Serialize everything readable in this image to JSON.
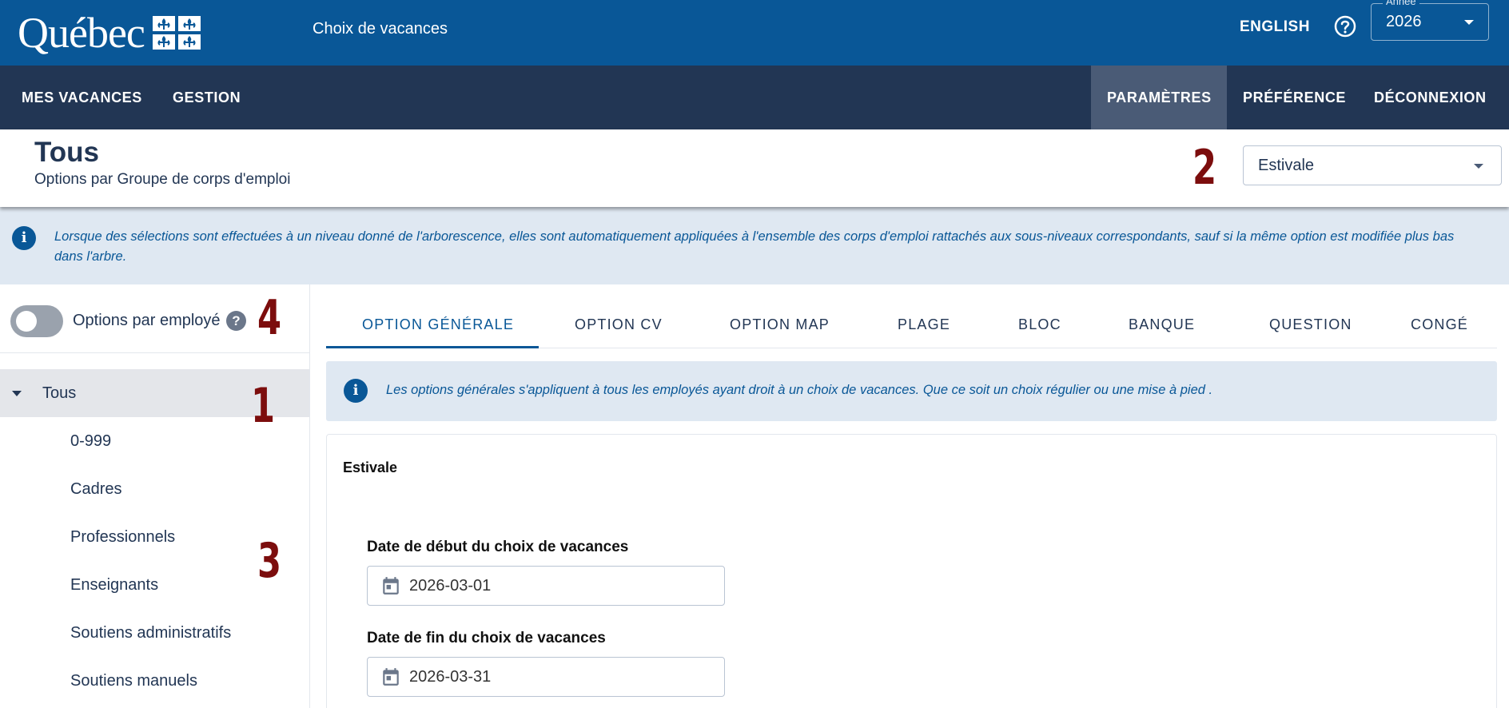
{
  "header": {
    "logo_text": "Québec",
    "app_title": "Choix de vacances",
    "language_link": "ENGLISH",
    "help_icon": "help-circle-icon",
    "year": {
      "legend": "Année",
      "value": "2026"
    }
  },
  "nav": {
    "left": [
      "MES VACANCES",
      "GESTION"
    ],
    "right": [
      "PARAMÈTRES",
      "PRÉFÉRENCE",
      "DÉCONNEXION"
    ],
    "active": "PARAMÈTRES"
  },
  "page": {
    "title": "Tous",
    "subtitle": "Options par Groupe de corps d'emploi",
    "season_select": "Estivale"
  },
  "annotations": [
    "1",
    "2",
    "3",
    "4"
  ],
  "info_banner": "Lorsque des sélections sont effectuées à un niveau donné de l'arborescence, elles sont automatiquement appliquées à l'ensemble des corps d'emploi rattachés aux sous-niveaux correspondants, sauf si la même option est modifiée plus bas dans l'arbre.",
  "sidebar": {
    "toggle_label": "Options par employé",
    "toggle_on": false,
    "help_glyph": "?",
    "tree": {
      "root": "Tous",
      "children": [
        "0-999",
        "Cadres",
        "Professionnels",
        "Enseignants",
        "Soutiens administratifs",
        "Soutiens manuels"
      ]
    }
  },
  "tabs": [
    "OPTION GÉNÉRALE",
    "OPTION CV",
    "OPTION MAP",
    "PLAGE",
    "BLOC",
    "BANQUE",
    "QUESTION",
    "CONGÉ"
  ],
  "active_tab": "OPTION GÉNÉRALE",
  "content": {
    "info_text": "Les options générales s'appliquent à tous les employés ayant droit à un choix de vacances. Que ce soit un choix régulier ou une mise à pied .",
    "section_title": "Estivale",
    "start_label": "Date de début du choix de vacances",
    "start_value": "2026-03-01",
    "end_label": "Date de fin du choix de vacances",
    "end_value": "2026-03-31"
  },
  "colors": {
    "brand_blue": "#095797",
    "nav_dark": "#223654",
    "info_bg": "#dfe8f2",
    "annotation_red": "#7c0d0d"
  }
}
